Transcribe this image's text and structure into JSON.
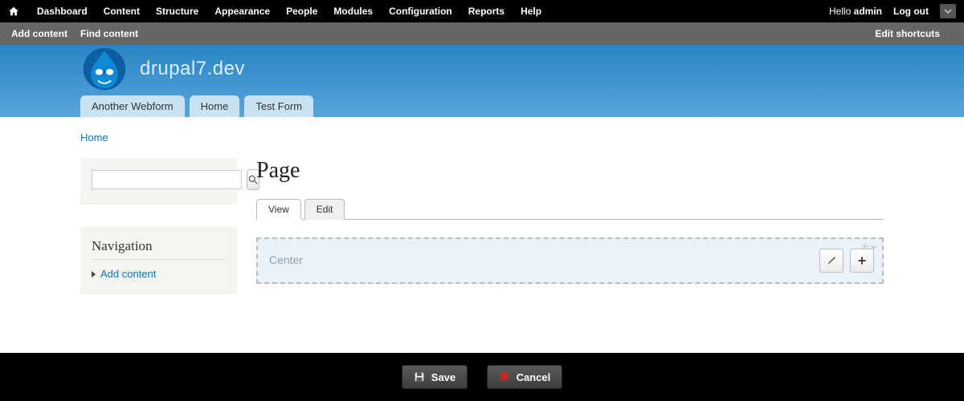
{
  "toolbar": {
    "items": [
      "Dashboard",
      "Content",
      "Structure",
      "Appearance",
      "People",
      "Modules",
      "Configuration",
      "Reports",
      "Help"
    ],
    "hello_prefix": "Hello ",
    "user": "admin",
    "logout": "Log out"
  },
  "shortcuts": {
    "items": [
      "Add content",
      "Find content"
    ],
    "edit": "Edit shortcuts"
  },
  "site": {
    "name": "drupal7.dev",
    "main_menu": [
      "Another Webform",
      "Home",
      "Test Form"
    ]
  },
  "breadcrumb": {
    "home": "Home"
  },
  "search": {
    "placeholder": ""
  },
  "navigation": {
    "title": "Navigation",
    "add_content": "Add content"
  },
  "page": {
    "title": "Page",
    "tabs": {
      "view": "View",
      "edit": "Edit"
    }
  },
  "panel": {
    "region_label": "Center"
  },
  "footer": {
    "save": "Save",
    "cancel": "Cancel"
  }
}
